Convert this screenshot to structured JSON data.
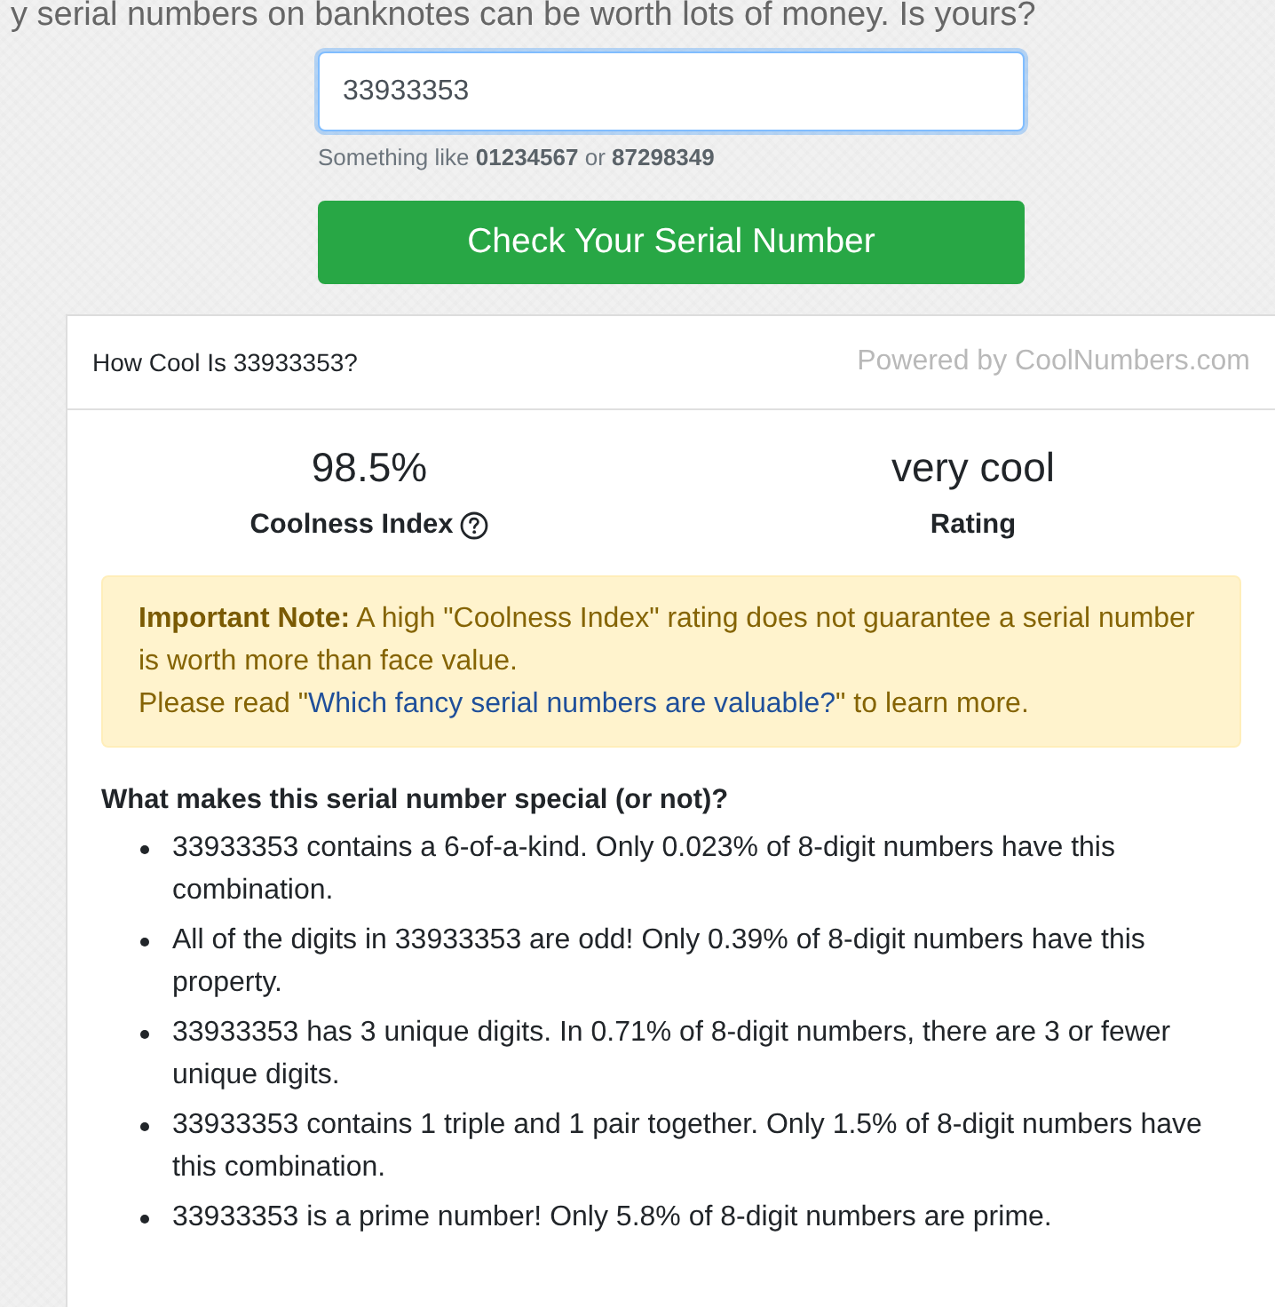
{
  "tagline": "y serial numbers on banknotes can be worth lots of money. Is yours?",
  "serial_field": {
    "value": "33933353",
    "focused": true
  },
  "hint": "Something like **01234567** or **87298349**",
  "check_button": "Check Your Serial Number",
  "result": {
    "title": "How Cool Is 33933353?",
    "powered_by": "Powered by CoolNumbers.com",
    "stats": [
      {
        "value": "98.5%",
        "label": "Coolness Index",
        "help": true
      },
      {
        "value": "very cool",
        "label": "Rating",
        "help": false
      }
    ],
    "note": {
      "text": "**Important Note:** A high \"Coolness Index\" rating does not guarantee a serial number is worth more than face value.",
      "before_link": "Please read \"",
      "link": "Which fancy serial numbers are valuable?",
      "after_link": "\" to learn more."
    },
    "facts_heading": "What makes this serial number special (or not)?",
    "facts": [
      "33933353 contains a 6-of-a-kind. Only 0.023% of 8-digit numbers have this combination.",
      "All of the digits in 33933353 are odd! Only 0.39% of 8-digit numbers have this property.",
      "33933353 has 3 unique digits. In 0.71% of 8-digit numbers, there are 3 or fewer unique digits.",
      "33933353 contains 1 triple and 1 pair together. Only 1.5% of 8-digit numbers have this combination.",
      "33933353 is a prime number! Only 5.8% of 8-digit numbers are prime."
    ]
  }
}
